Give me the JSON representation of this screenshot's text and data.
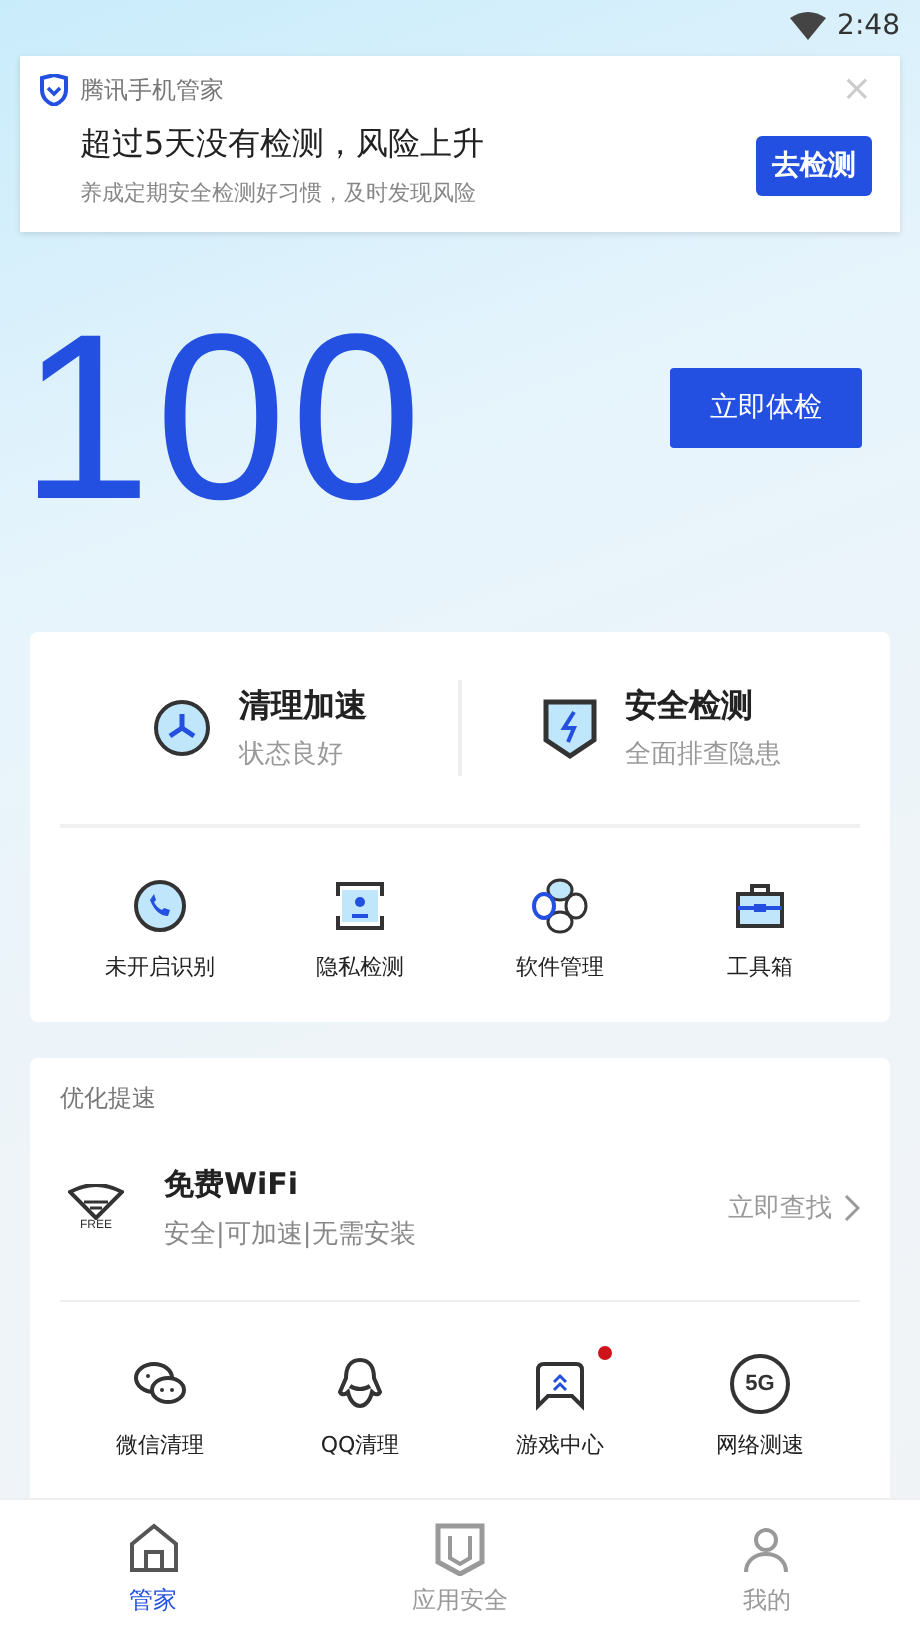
{
  "status_bar": {
    "time": "2:48"
  },
  "notification": {
    "app": "腾讯手机管家",
    "title": "超过5天没有检测，风险上升",
    "subtitle": "养成定期安全检测好习惯，及时发现风险",
    "action": "去检测",
    "close": "×"
  },
  "score": {
    "value": "100",
    "button": "立即体检"
  },
  "main_features": [
    {
      "kind": "clean",
      "title": "清理加速",
      "subtitle": "状态良好"
    },
    {
      "kind": "security",
      "title": "安全检测",
      "subtitle": "全面排查隐患"
    }
  ],
  "tools": [
    {
      "kind": "call",
      "label": "未开启识别"
    },
    {
      "kind": "privacy",
      "label": "隐私检测"
    },
    {
      "kind": "apps",
      "label": "软件管理"
    },
    {
      "kind": "toolbox",
      "label": "工具箱"
    }
  ],
  "optimize": {
    "heading": "优化提速",
    "wifi": {
      "icon_caption": "FREE",
      "title": "免费WiFi",
      "subtitle": "安全|可加速|无需安装",
      "action": "立即查找"
    },
    "items": [
      {
        "kind": "wechat",
        "label": "微信清理",
        "unread": false
      },
      {
        "kind": "qq",
        "label": "QQ清理",
        "unread": false
      },
      {
        "kind": "game",
        "label": "游戏中心",
        "unread": true
      },
      {
        "kind": "speed",
        "label": "网络测速",
        "unread": false,
        "icon_text": "5G"
      }
    ]
  },
  "bottom_nav": [
    {
      "kind": "home",
      "label": "管家",
      "selected": true
    },
    {
      "kind": "shield",
      "label": "应用安全",
      "selected": false
    },
    {
      "kind": "me",
      "label": "我的",
      "selected": false
    }
  ]
}
